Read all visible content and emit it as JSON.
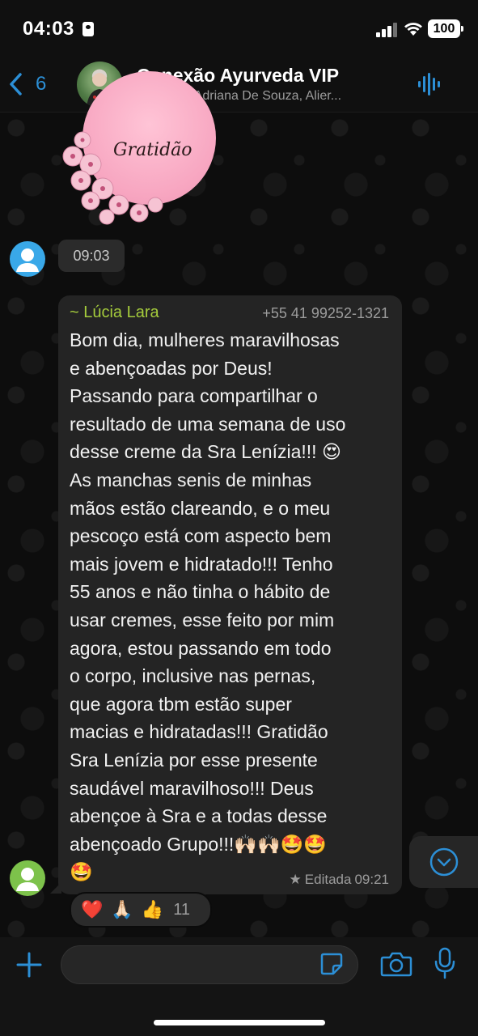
{
  "status_bar": {
    "time": "04:03",
    "battery": "100"
  },
  "header": {
    "back_count": "6",
    "title": "Conexão Ayurveda VIP",
    "members": "~Heloisa, Adriana De Souza, Alier..."
  },
  "sticker": {
    "text": "Gratidão"
  },
  "time_pill": "09:03",
  "message": {
    "sender_name": "~ Lúcia Lara",
    "sender_phone": "+55 41 99252-1321",
    "text": "Bom dia, mulheres maravilhosas\ne abençoadas por Deus!\nPassando para compartilhar o\nresultado de uma semana de uso\ndesse creme da Sra Lenízia!!! 😍\nAs manchas senis de minhas\nmãos estão clareando, e o meu\npescoço está com aspecto bem\nmais jovem e hidratado!!! Tenho\n55 anos e não tinha o hábito de\nusar cremes, esse feito por mim\nagora, estou passando em todo\no corpo, inclusive nas pernas,\nque agora tbm estão super\nmacias e hidratadas!!! Gratidão\nSra Lenízia por esse presente\nsaudável maravilhoso!!! Deus\nabençoe à Sra e a todas desse\nabençoado Grupo!!!🙌🏻🙌🏻🤩🤩\n🤩",
    "edited_label": "Editada",
    "time": "09:21"
  },
  "reactions": {
    "emojis": [
      "❤️",
      "🙏🏻",
      "👍"
    ],
    "count": "11"
  },
  "colors": {
    "accent": "#2c8fd6",
    "sender_name": "#a5cc3c",
    "bubble": "#242424"
  }
}
